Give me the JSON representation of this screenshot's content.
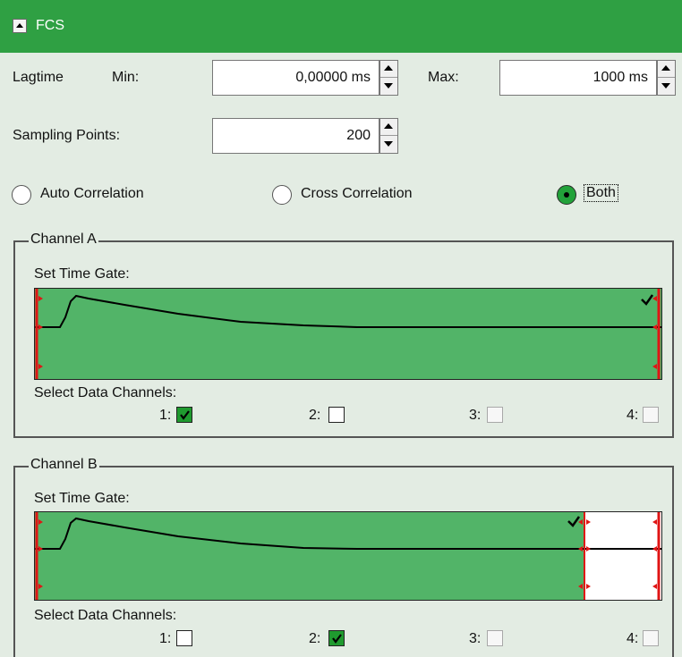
{
  "header": {
    "title": "FCS"
  },
  "lagtime": {
    "label": "Lagtime",
    "min_label": "Min:",
    "min_value": "0,00000 ms",
    "max_label": "Max:",
    "max_value": "1000 ms"
  },
  "sampling": {
    "label": "Sampling Points:",
    "value": "200"
  },
  "correlation": {
    "options": [
      "Auto Correlation",
      "Cross Correlation",
      "Both"
    ],
    "selected": "Both"
  },
  "channel_a": {
    "title": "Channel A",
    "time_gate_label": "Set Time Gate:",
    "data_channels_label": "Select Data Channels:",
    "channels": [
      {
        "label": "1:",
        "state": "checked"
      },
      {
        "label": "2:",
        "state": "unchecked"
      },
      {
        "label": "3:",
        "state": "disabled"
      },
      {
        "label": "4:",
        "state": "disabled"
      }
    ]
  },
  "channel_b": {
    "title": "Channel B",
    "time_gate_label": "Set Time Gate:",
    "data_channels_label": "Select Data Channels:",
    "channels": [
      {
        "label": "1:",
        "state": "unchecked"
      },
      {
        "label": "2:",
        "state": "checked"
      },
      {
        "label": "3:",
        "state": "disabled"
      },
      {
        "label": "4:",
        "state": "disabled"
      }
    ]
  },
  "colors": {
    "header": "#2fa043",
    "gate_fill": "#52b468",
    "marker": "#e01515"
  }
}
